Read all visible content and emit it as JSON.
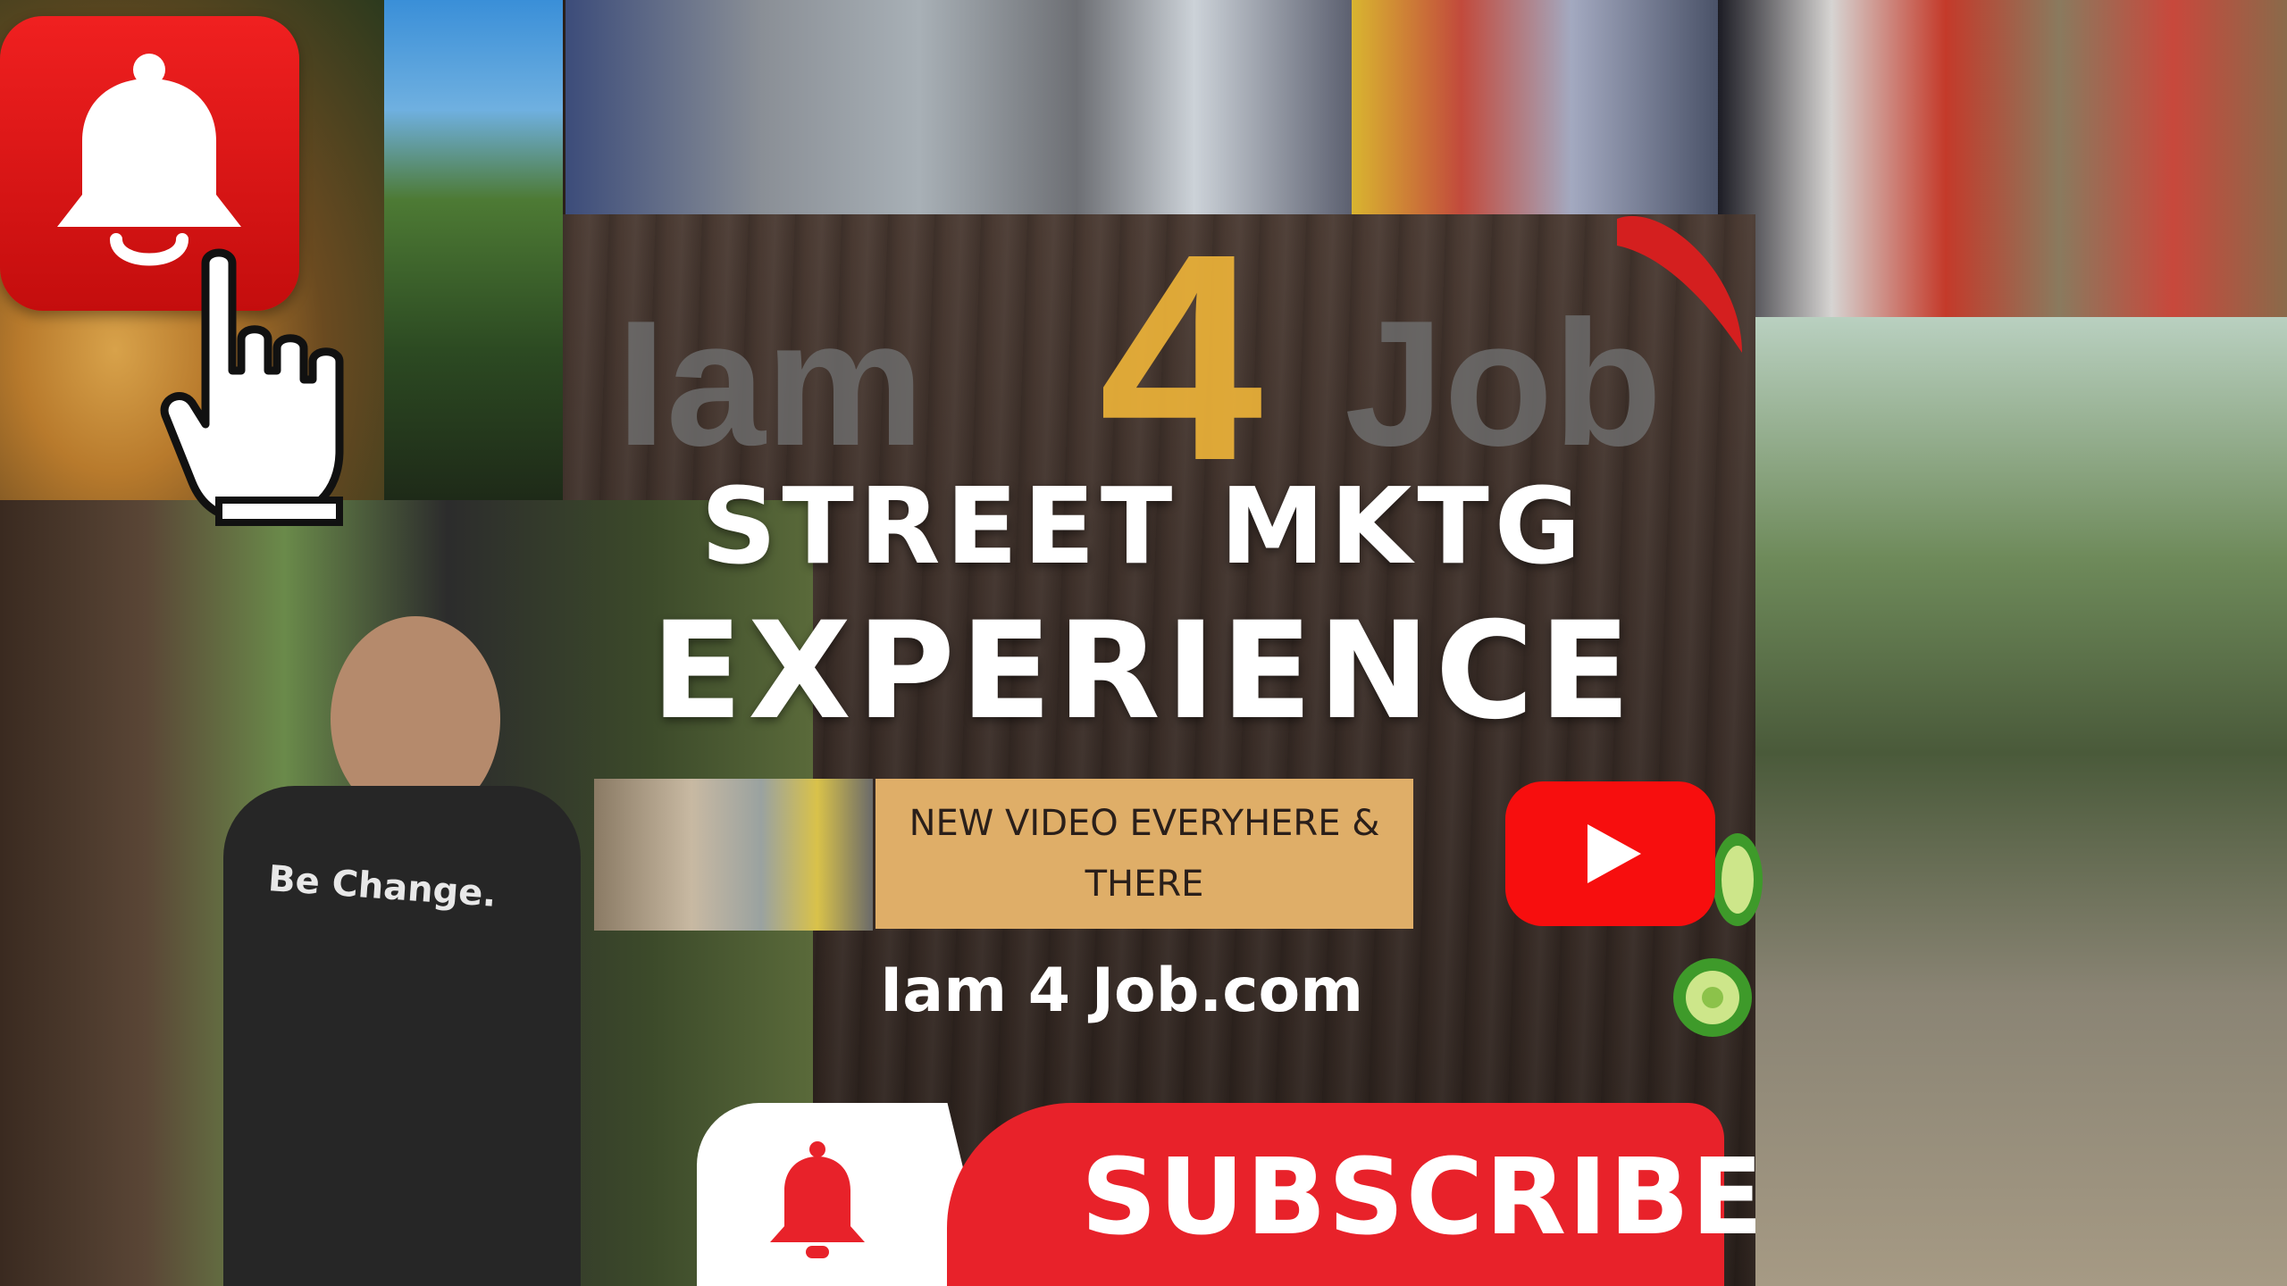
{
  "logo": {
    "iam": "Iam",
    "four": "4",
    "job": "Job"
  },
  "headline": {
    "line1": "STREET MKTG",
    "line2": "EXPERIENCE"
  },
  "shirt_text": "Be Change.",
  "new_video": "NEW VIDEO EVERYHERE & THERE",
  "site": {
    "url": "Iam 4 Job.com"
  },
  "subscribe": {
    "label": "SUBSCRIBE"
  },
  "icons": {
    "notify_bell": "bell-icon",
    "pointer": "hand-pointer-icon",
    "youtube": "youtube-play-icon",
    "subscribe_bell": "bell-icon"
  },
  "colors": {
    "youtube_red": "#f70e0e",
    "subscribe_red": "#e8222a",
    "accent_gold": "#ecb238",
    "box_tan": "#dfae68"
  }
}
